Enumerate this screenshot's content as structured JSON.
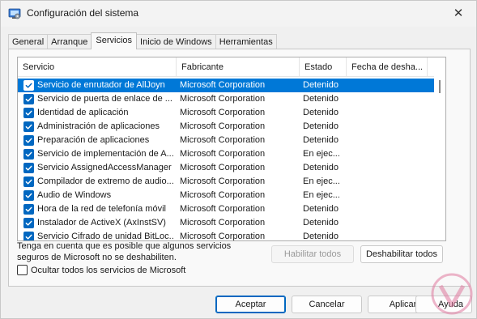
{
  "window": {
    "title": "Configuración del sistema",
    "close_glyph": "✕",
    "icon": "system-config-icon"
  },
  "tabs": [
    {
      "label": "General",
      "active": false
    },
    {
      "label": "Arranque",
      "active": false
    },
    {
      "label": "Servicios",
      "active": true
    },
    {
      "label": "Inicio de Windows",
      "active": false
    },
    {
      "label": "Herramientas",
      "active": false
    }
  ],
  "services_list": {
    "columns": [
      "Servicio",
      "Fabricante",
      "Estado",
      "Fecha de desha..."
    ],
    "rows": [
      {
        "name": "Servicio de enrutador de AllJoyn",
        "manufacturer": "Microsoft Corporation",
        "status": "Detenido",
        "disabled_date": "",
        "checked": true,
        "selected": true
      },
      {
        "name": "Servicio de puerta de enlace de ...",
        "manufacturer": "Microsoft Corporation",
        "status": "Detenido",
        "disabled_date": "",
        "checked": true,
        "selected": false
      },
      {
        "name": "Identidad de aplicación",
        "manufacturer": "Microsoft Corporation",
        "status": "Detenido",
        "disabled_date": "",
        "checked": true,
        "selected": false
      },
      {
        "name": "Administración de aplicaciones",
        "manufacturer": "Microsoft Corporation",
        "status": "Detenido",
        "disabled_date": "",
        "checked": true,
        "selected": false
      },
      {
        "name": "Preparación de aplicaciones",
        "manufacturer": "Microsoft Corporation",
        "status": "Detenido",
        "disabled_date": "",
        "checked": true,
        "selected": false
      },
      {
        "name": "Servicio de implementación de A...",
        "manufacturer": "Microsoft Corporation",
        "status": "En ejec...",
        "disabled_date": "",
        "checked": true,
        "selected": false
      },
      {
        "name": "Servicio AssignedAccessManager",
        "manufacturer": "Microsoft Corporation",
        "status": "Detenido",
        "disabled_date": "",
        "checked": true,
        "selected": false
      },
      {
        "name": "Compilador de extremo de audio...",
        "manufacturer": "Microsoft Corporation",
        "status": "En ejec...",
        "disabled_date": "",
        "checked": true,
        "selected": false
      },
      {
        "name": "Audio de Windows",
        "manufacturer": "Microsoft Corporation",
        "status": "En ejec...",
        "disabled_date": "",
        "checked": true,
        "selected": false
      },
      {
        "name": "Hora de la red de telefonía móvil",
        "manufacturer": "Microsoft Corporation",
        "status": "Detenido",
        "disabled_date": "",
        "checked": true,
        "selected": false
      },
      {
        "name": "Instalador de ActiveX (AxInstSV)",
        "manufacturer": "Microsoft Corporation",
        "status": "Detenido",
        "disabled_date": "",
        "checked": true,
        "selected": false
      },
      {
        "name": "Servicio Cifrado de unidad BitLoc...",
        "manufacturer": "Microsoft Corporation",
        "status": "Detenido",
        "disabled_date": "",
        "checked": true,
        "selected": false
      }
    ]
  },
  "note": "Tenga en cuenta que es posible que algunos servicios seguros de Microsoft no se deshabiliten.",
  "buttons": {
    "enable_all": "Habilitar todos",
    "disable_all": "Deshabilitar todos",
    "accept": "Aceptar",
    "cancel": "Cancelar",
    "apply": "Aplicar",
    "help": "Ayuda"
  },
  "hide_ms": {
    "label": "Ocultar todos los servicios de Microsoft",
    "checked": false
  },
  "colors": {
    "accent": "#0067c0",
    "selection": "#0078d7"
  }
}
